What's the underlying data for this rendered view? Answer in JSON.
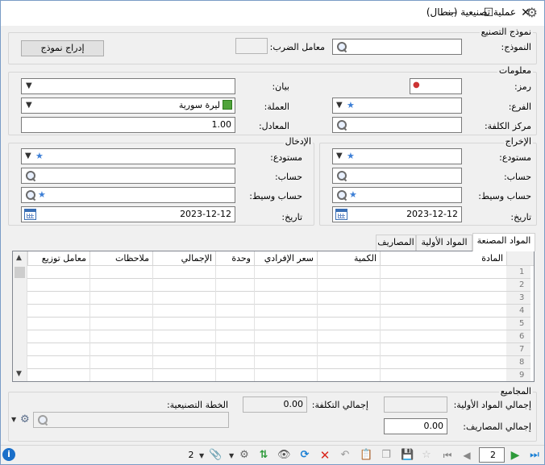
{
  "window": {
    "title": "عملية تصنيعية (بنطال)"
  },
  "model": {
    "section_title": "نموذج التصنيع",
    "model_label": "النموذج:",
    "factor_label": "معامل الضرب:",
    "factor_value": "",
    "insert_button": "إدراج نموذج"
  },
  "info": {
    "section_title": "معلومات",
    "code_label": "رمز:",
    "statement_label": "بيان:",
    "branch_label": "الفرع:",
    "currency_label": "العملة:",
    "currency_value": "ليرة سورية",
    "cost_center_label": "مركز الكلفة:",
    "rate_label": "المعادل:",
    "rate_value": "1.00"
  },
  "output": {
    "section_title": "الإخراج",
    "warehouse_label": "مستودع:",
    "account_label": "حساب:",
    "intermediate_label": "حساب وسيط:",
    "date_label": "تاريخ:",
    "date_value": "2023-12-12"
  },
  "input": {
    "section_title": "الإدخال",
    "warehouse_label": "مستودع:",
    "account_label": "حساب:",
    "intermediate_label": "حساب وسيط:",
    "date_label": "تاريخ:",
    "date_value": "2023-12-12"
  },
  "tabs": [
    {
      "label": "المواد المصنعة"
    },
    {
      "label": "المواد الأولية"
    },
    {
      "label": "المصاريف"
    }
  ],
  "grid": {
    "columns": [
      "المادة",
      "الكمية",
      "سعر الإفرادي",
      "وحدة",
      "الإجمالي",
      "ملاحظات",
      "معامل توزيع"
    ],
    "rows": [
      "1",
      "2",
      "3",
      "4",
      "5",
      "6",
      "7",
      "8",
      "9"
    ]
  },
  "totals": {
    "section_title": "المجاميع",
    "raw_total_label": "إجمالي المواد الأولية:",
    "raw_total_value": "",
    "cost_total_label": "إجمالي التكلفة:",
    "cost_total_value": "0.00",
    "plan_label": "الخطة التصنيعية:",
    "expenses_total_label": "إجمالي المصاريف:",
    "expenses_total_value": "0.00"
  },
  "toolbar": {
    "record_count": "2",
    "page_value": "2"
  },
  "colors": {
    "accent": "#3a6fb5",
    "delete": "#d9261c",
    "nav": "#1a7fd4"
  }
}
